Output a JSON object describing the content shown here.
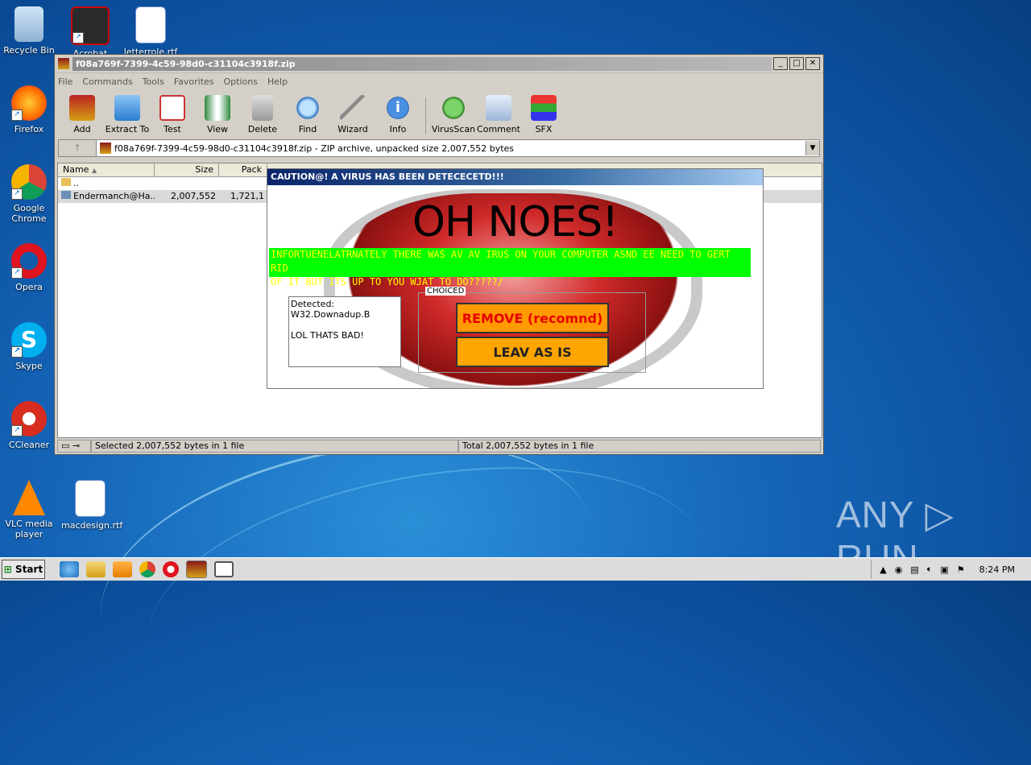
{
  "desktop": {
    "icons": [
      {
        "label": "Recycle Bin"
      },
      {
        "label": "Acrobat"
      },
      {
        "label": "letterrole.rtf"
      },
      {
        "label": "Firefox"
      },
      {
        "label": "Google Chrome"
      },
      {
        "label": "Opera"
      },
      {
        "label": "Skype"
      },
      {
        "label": "CCleaner"
      },
      {
        "label": "VLC media player"
      },
      {
        "label": "macdesign.rtf"
      }
    ],
    "watermark": "ANY ▷ RUN"
  },
  "window": {
    "title": "f08a769f-7399-4c59-98d0-c31104c3918f.zip",
    "menu": [
      "File",
      "Commands",
      "Tools",
      "Favorites",
      "Options",
      "Help"
    ],
    "toolbar": [
      "Add",
      "Extract To",
      "Test",
      "View",
      "Delete",
      "Find",
      "Wizard",
      "Info",
      "VirusScan",
      "Comment",
      "SFX"
    ],
    "address": "f08a769f-7399-4c59-98d0-c31104c3918f.zip - ZIP archive, unpacked size 2,007,552 bytes",
    "columns": {
      "name": "Name",
      "size": "Size",
      "packed": "Pack"
    },
    "rows": [
      {
        "name": "..",
        "size": "",
        "packed": ""
      },
      {
        "name": "Endermanch@Ha...",
        "size": "2,007,552",
        "packed": "1,721,1"
      }
    ],
    "status_left": "Selected 2,007,552 bytes in 1 file",
    "status_right": "Total 2,007,552 bytes in 1 file"
  },
  "dialog": {
    "title": "CAUTION@! A VIRUS HAS BEEN DETECECETD!!!",
    "headline": "OH NOES!",
    "warning_line1": "INFORTUENELATRNATELY THERE WAS AV AV IRUS ON YOUR COMPUTER ASND EE NEED TO GERT RID",
    "warning_line2": "OF IT BUT ITS UP TO YOU WJAT TO DO?????/",
    "detected_label": "Detected:",
    "detected_value": "W32.Downadup.B",
    "detected_comment": "LOL THATS BAD!",
    "group_label": "CHOICED",
    "remove_button": "REMOVE (recomnd)",
    "leave_button": "LEAV AS IS"
  },
  "taskbar": {
    "start_label": "Start",
    "time": "8:24 PM"
  }
}
